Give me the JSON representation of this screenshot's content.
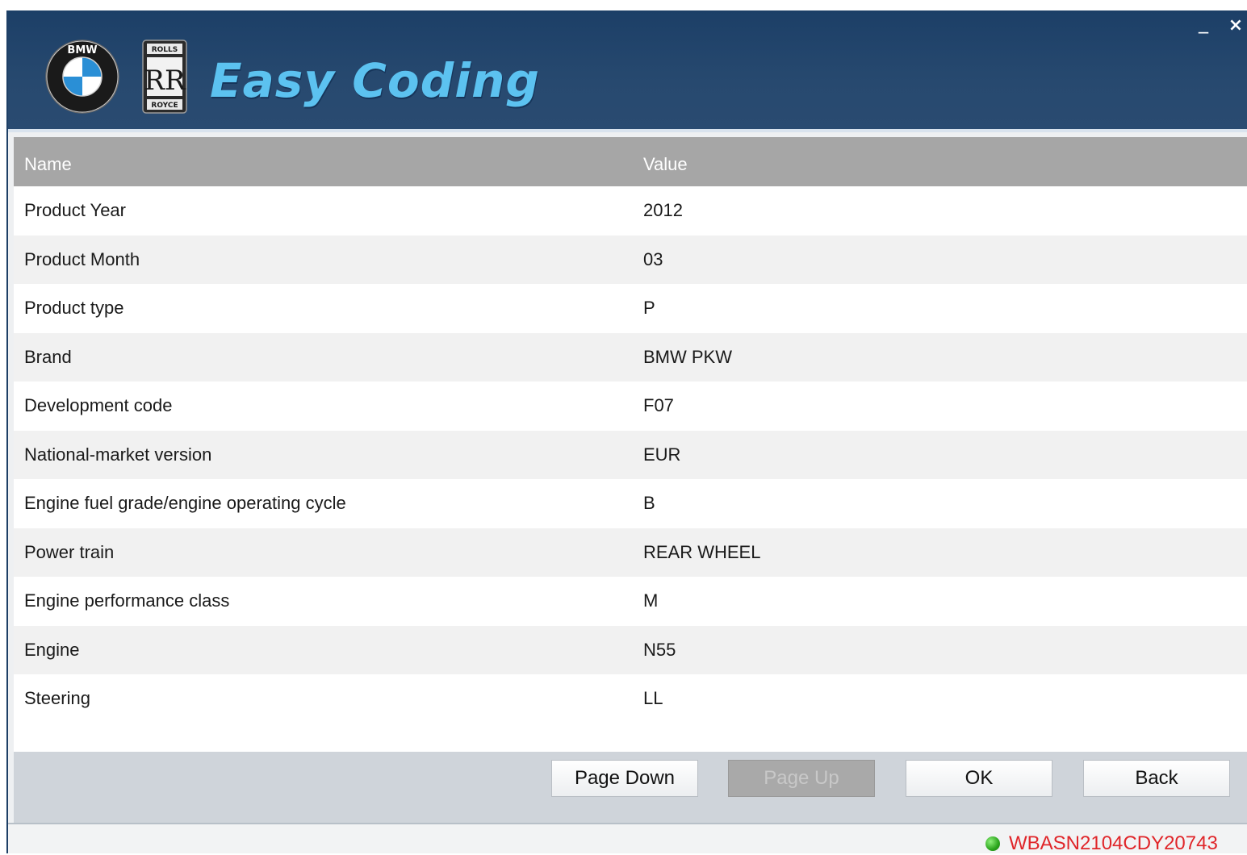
{
  "header": {
    "logo_text": "Easy Coding",
    "bmw_logo_text": "BMW",
    "rr_logo_top": "ROLLS",
    "rr_logo_mid": "RR",
    "rr_logo_bottom": "ROYCE",
    "minimize_label": "_",
    "close_label": "×"
  },
  "table": {
    "columns": [
      "Name",
      "Value"
    ],
    "rows": [
      {
        "name": "Product Year",
        "value": "2012"
      },
      {
        "name": "Product Month",
        "value": "03"
      },
      {
        "name": "Product type",
        "value": "P"
      },
      {
        "name": "Brand",
        "value": "BMW PKW"
      },
      {
        "name": "Development code",
        "value": "F07"
      },
      {
        "name": "National-market version",
        "value": "EUR"
      },
      {
        "name": "Engine fuel grade/engine operating cycle",
        "value": "B"
      },
      {
        "name": "Power train",
        "value": "REAR WHEEL"
      },
      {
        "name": "Engine performance class",
        "value": "M"
      },
      {
        "name": "Engine",
        "value": "N55"
      },
      {
        "name": "Steering",
        "value": "LL"
      }
    ]
  },
  "buttons": {
    "page_down": "Page Down",
    "page_up": "Page Up",
    "ok": "OK",
    "back": "Back"
  },
  "status": {
    "vin": "WBASN2104CDY20743",
    "indicator_color": "#2aa41c"
  },
  "colors": {
    "header_bg": "#1c3f67",
    "logo_accent": "#5cc2f0",
    "table_header_bg": "#a6a6a6",
    "vin_color": "#e0262a"
  }
}
